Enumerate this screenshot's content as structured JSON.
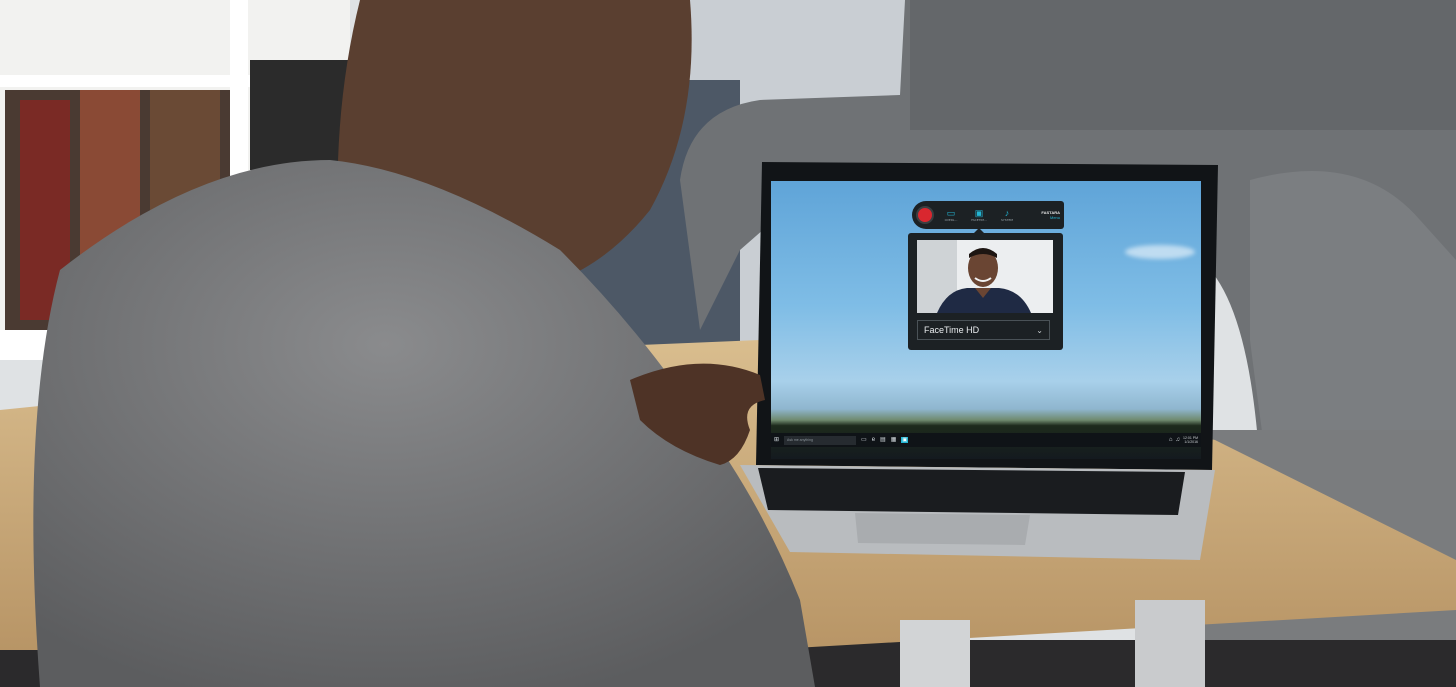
{
  "scene": {
    "colors": {
      "wall": "#e7e9ea",
      "sofa": "#6f7275",
      "table": "#c9a97a",
      "shirt": "#6d6e70",
      "skin": "#5a3f30",
      "laptop": "#b9bcbf",
      "screen_sky": "#7fbde6"
    }
  },
  "recorder": {
    "record_icon": "record-button-icon",
    "tools": [
      {
        "icon": "monitor-icon",
        "label": "OVERL..."
      },
      {
        "icon": "camera-icon",
        "label": "FACETIM..."
      },
      {
        "icon": "microphone-icon",
        "label": "SYSTEM"
      }
    ],
    "brand": {
      "name": "FASTARA",
      "menu": "Menu"
    },
    "accent": "#23b5d3",
    "record_color": "#d9272f"
  },
  "camera_panel": {
    "source_selected": "FaceTime HD"
  },
  "taskbar": {
    "search_placeholder": "Ask me anything",
    "time": "12:01 PM",
    "date": "1/1/2016"
  }
}
